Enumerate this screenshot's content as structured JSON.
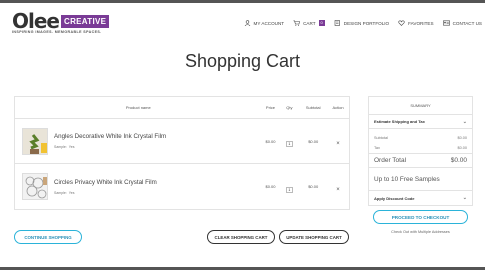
{
  "header": {
    "logo_word": "Olee",
    "logo_badge": "CREATIVE",
    "logo_mark": "TM",
    "tagline": "INSPIRING IMAGES. MEMORABLE SPACES.",
    "nav": {
      "account": "MY ACCOUNT",
      "cart": "CART",
      "cart_count": "0",
      "portfolio": "DESIGN PORTFOLIO",
      "favorites": "FAVORITES",
      "contact": "CONTACT US"
    }
  },
  "page_title": "Shopping Cart",
  "table": {
    "headers": {
      "name": "Product name",
      "price": "Price",
      "qty": "Qty",
      "subtotal": "Subtotal",
      "action": "Action"
    },
    "items": [
      {
        "name": "Angles Decorative White Ink Crystal Film",
        "meta_key": "Sample:",
        "meta_val": "Yes",
        "price": "$0.00",
        "qty": "1",
        "subtotal": "$0.00",
        "remove": "×"
      },
      {
        "name": "Circles Privacy White Ink Crystal Film",
        "meta_key": "Sample:",
        "meta_val": "Yes",
        "price": "$0.00",
        "qty": "1",
        "subtotal": "$0.00",
        "remove": "×"
      }
    ]
  },
  "buttons": {
    "continue": "CONTINUE SHOPPING",
    "clear": "CLEAR SHOPPING CART",
    "update": "UPDATE SHOPPING CART"
  },
  "summary": {
    "title": "SUMMARY",
    "shipping": "Estimate Shipping and Tax",
    "subtotal_label": "Subtotal",
    "subtotal_value": "$0.00",
    "tax_label": "Tax",
    "tax_value": "$0.00",
    "total_label": "Order Total",
    "total_value": "$0.00",
    "samples": "Up to 10 Free Samples",
    "discount": "Apply Discount Code",
    "checkout": "PROCEED TO CHECKOUT",
    "multi": "Check Out with Multiple Addresses"
  },
  "colors": {
    "brand": "#7a3b96",
    "accent": "#2bb3d9"
  }
}
